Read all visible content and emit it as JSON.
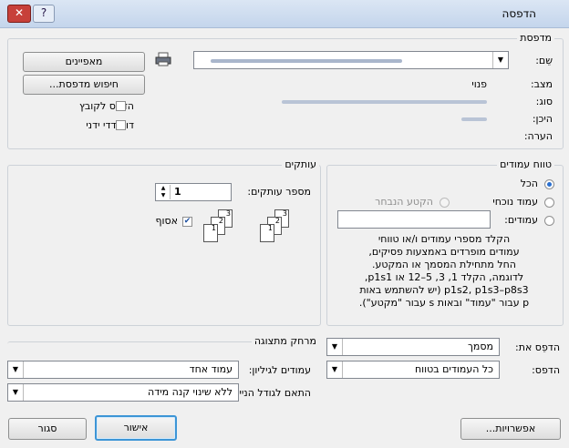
{
  "window": {
    "title": "הדפסה",
    "close_glyph": "✕",
    "help_glyph": "?"
  },
  "printer": {
    "group_label": "מדפסת",
    "name_label": "שֵם:",
    "status_label": "מצב:",
    "status_value": "פנוי",
    "type_label": "סוג:",
    "where_label": "היכן:",
    "comment_label": "הערה:",
    "properties_button": "מאפיינים",
    "find_printer_button": "חיפוש מדפסת...",
    "print_to_file_label": "הדפס לקובץ",
    "manual_duplex_label": "דו-צדדי ידני"
  },
  "page_range": {
    "group_label": "טווח עמודים",
    "all_label": "הכל",
    "current_page_label": "עמוד נוכחי",
    "selection_label": "הקטע הנבחר",
    "pages_label": "עמודים:",
    "pages_value": "",
    "help_text": [
      "הקלד מספרי עמודים ו/או טווחי",
      "עמודים מופרדים באמצעות פסיקים,",
      "החל מתחילת המסמך או המקטע.",
      "לדוגמה, הקלד 1, 3, 5–12 או p1s1,",
      "p1s2, p1s3–p8s3 (יש להשתמש באות",
      "p עבור \"עמוד\" ובאות s עבור \"מקטע\")."
    ]
  },
  "copies": {
    "group_label": "עותקים",
    "count_label": "מספר עותקים:",
    "count_value": "1",
    "collate_label": "אסוף",
    "page_numbers": [
      "1",
      "2",
      "3"
    ]
  },
  "print_what": {
    "label": "הדפֵס את:",
    "value": "מסמך"
  },
  "print": {
    "label": "הדפס:",
    "value": "כל העמודים בטווח"
  },
  "zoom": {
    "group_label": "מרחק מתצוגה",
    "pages_per_sheet_label": "עמודים לגיליון:",
    "pages_per_sheet_value": "עמוד אחד",
    "scale_label": "התאם לגודל הנייר:",
    "scale_value": "ללא שינוי קנה מידה"
  },
  "buttons": {
    "options": "אפשרויות...",
    "ok": "אישור",
    "close": "סגור"
  }
}
